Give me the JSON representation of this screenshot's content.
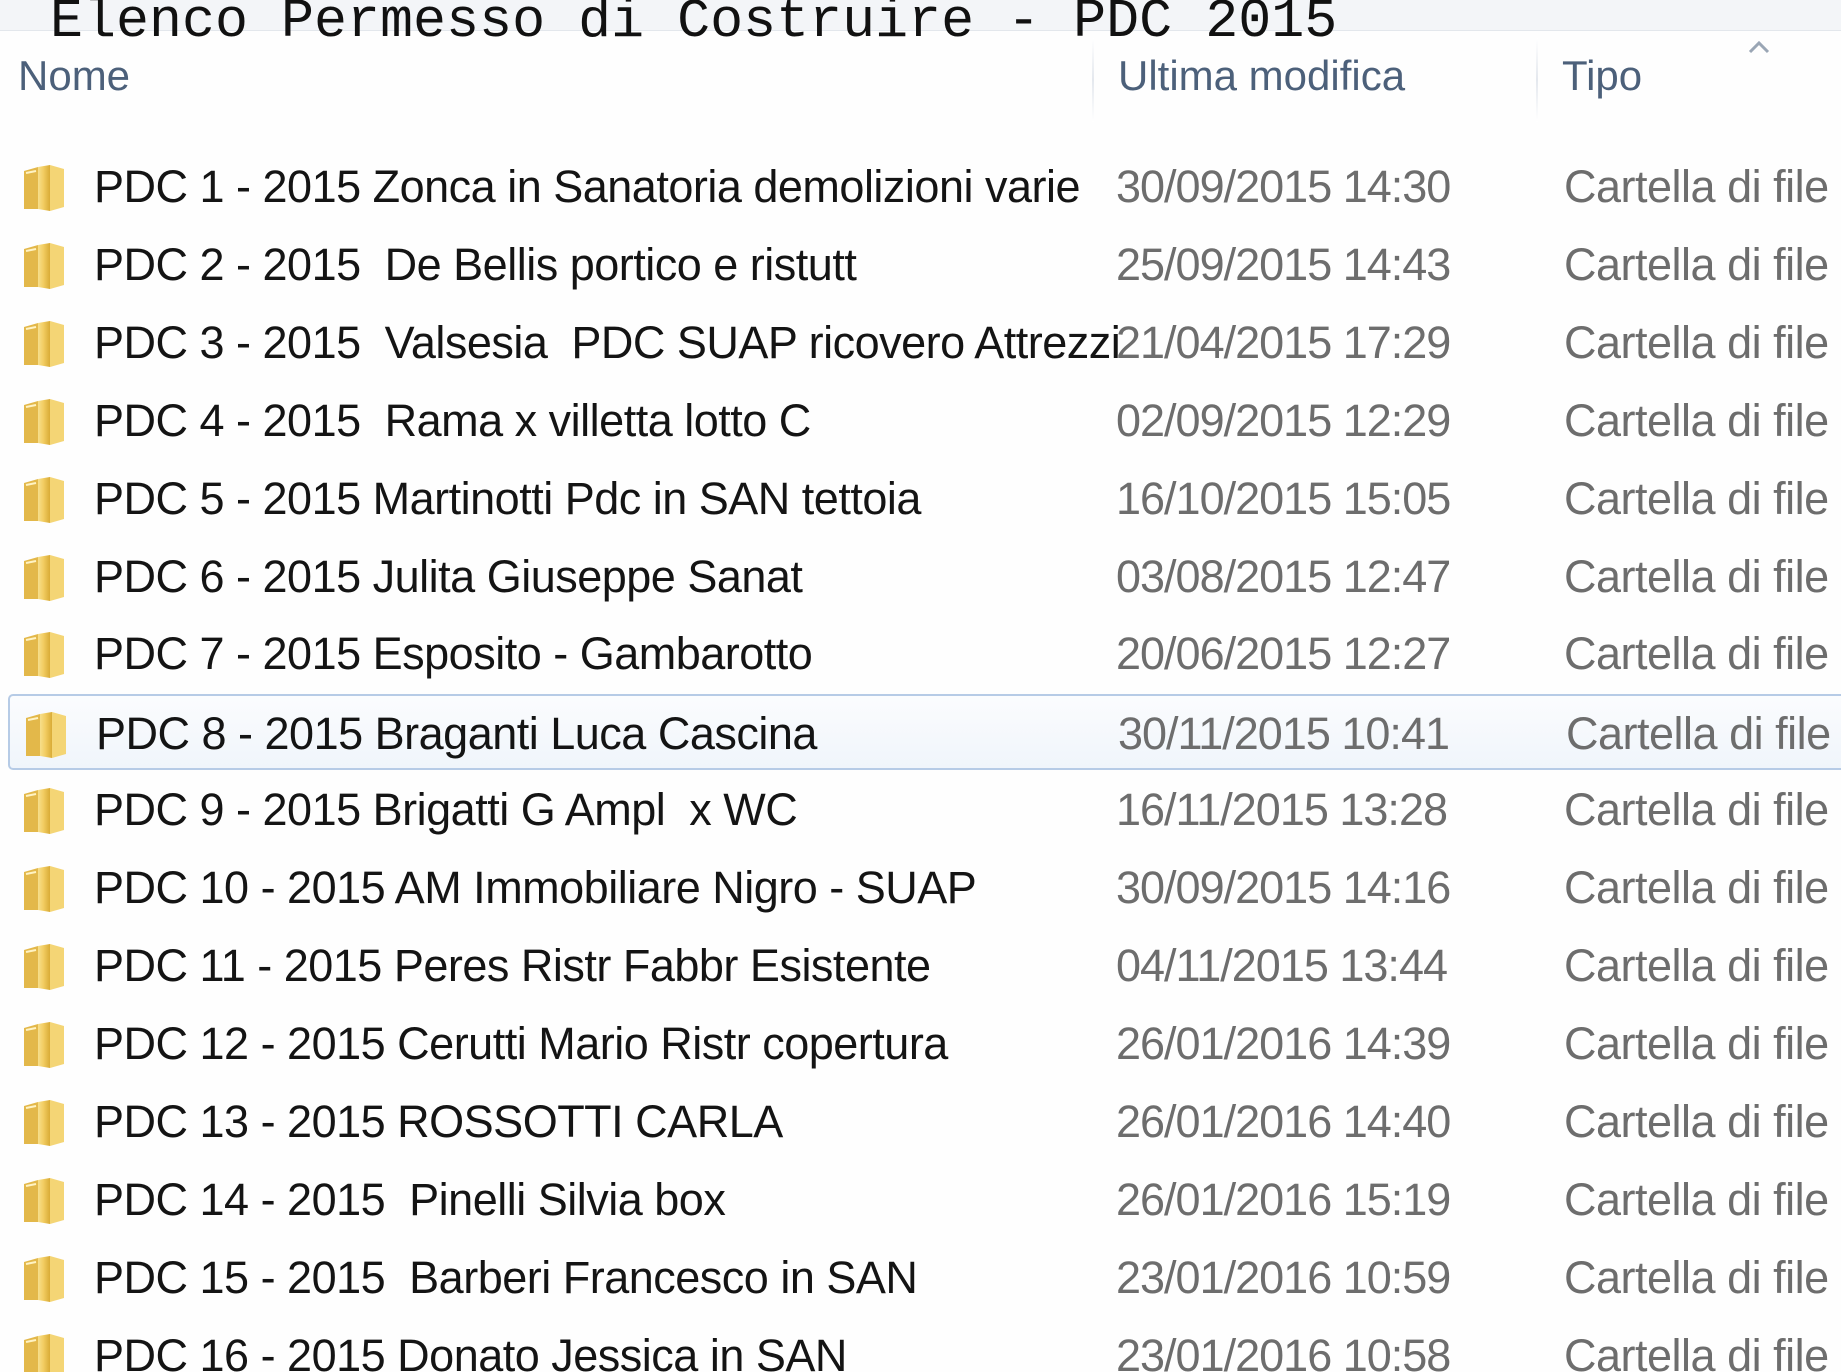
{
  "page_title": "Elenco Permesso di Costruire - PDC 2015",
  "columns": {
    "name": "Nome",
    "modified": "Ultima modifica",
    "type": "Tipo"
  },
  "icons": {
    "sort": "chevron-up-icon",
    "folder": "folder-icon"
  },
  "colors": {
    "header_text": "#4c607a",
    "selection_border": "#b6cbe6",
    "folder": "#e8c25a"
  },
  "selected_row": "PDC 8 - 2015 Braganti Luca Cascina",
  "files": [
    {
      "name": "PDC 1 - 2015 Zonca in Sanatoria demolizioni varie",
      "modified": "30/09/2015 14:30",
      "type": "Cartella di file"
    },
    {
      "name": "PDC 2 - 2015  De Bellis portico e ristutt",
      "modified": "25/09/2015 14:43",
      "type": "Cartella di file"
    },
    {
      "name": "PDC 3 - 2015  Valsesia  PDC SUAP ricovero Attrezzi",
      "modified": "21/04/2015 17:29",
      "type": "Cartella di file"
    },
    {
      "name": "PDC 4 - 2015  Rama x villetta lotto C",
      "modified": "02/09/2015 12:29",
      "type": "Cartella di file"
    },
    {
      "name": "PDC 5 - 2015 Martinotti Pdc in SAN tettoia",
      "modified": "16/10/2015 15:05",
      "type": "Cartella di file"
    },
    {
      "name": "PDC 6 - 2015 Julita Giuseppe Sanat",
      "modified": "03/08/2015 12:47",
      "type": "Cartella di file"
    },
    {
      "name": "PDC 7 - 2015 Esposito - Gambarotto",
      "modified": "20/06/2015 12:27",
      "type": "Cartella di file"
    },
    {
      "name": "PDC 8 - 2015 Braganti Luca Cascina",
      "modified": "30/11/2015 10:41",
      "type": "Cartella di file"
    },
    {
      "name": "PDC 9 - 2015 Brigatti G Ampl  x WC",
      "modified": "16/11/2015 13:28",
      "type": "Cartella di file"
    },
    {
      "name": "PDC 10 - 2015 AM Immobiliare Nigro - SUAP",
      "modified": "30/09/2015 14:16",
      "type": "Cartella di file"
    },
    {
      "name": "PDC 11 - 2015 Peres Ristr Fabbr Esistente",
      "modified": "04/11/2015 13:44",
      "type": "Cartella di file"
    },
    {
      "name": "PDC 12 - 2015 Cerutti Mario Ristr copertura",
      "modified": "26/01/2016 14:39",
      "type": "Cartella di file"
    },
    {
      "name": "PDC 13 - 2015 ROSSOTTI CARLA",
      "modified": "26/01/2016 14:40",
      "type": "Cartella di file"
    },
    {
      "name": "PDC 14 - 2015  Pinelli Silvia box",
      "modified": "26/01/2016 15:19",
      "type": "Cartella di file"
    },
    {
      "name": "PDC 15 - 2015  Barberi Francesco in SAN",
      "modified": "23/01/2016 10:59",
      "type": "Cartella di file"
    },
    {
      "name": "PDC 16 - 2015 Donato Jessica in SAN",
      "modified": "23/01/2016 10:58",
      "type": "Cartella di file"
    }
  ]
}
